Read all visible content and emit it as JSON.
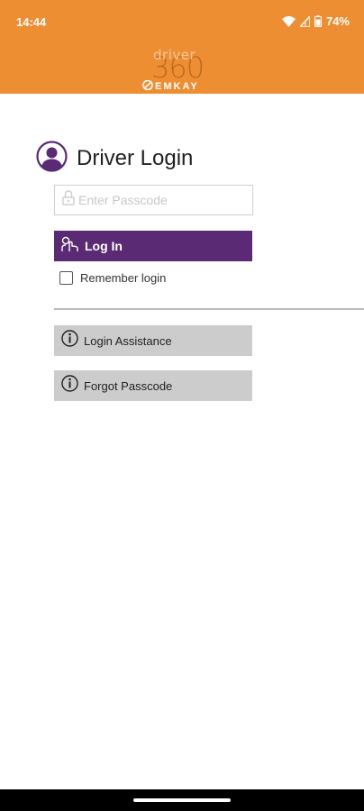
{
  "status_bar": {
    "time": "14:44",
    "battery": "74%",
    "icons": [
      "wifi-icon",
      "signal-icon",
      "battery-icon"
    ]
  },
  "header": {
    "logo": {
      "word_top": "driver",
      "word_mid": "360",
      "word_bottom": "EMKAY"
    }
  },
  "login": {
    "title": "Driver Login",
    "title_icon": "user-avatar-icon",
    "passcode_placeholder": "Enter Passcode",
    "passcode_value": "",
    "login_button": "Log In",
    "remember_label": "Remember login",
    "remember_checked": false
  },
  "help": {
    "assistance": "Login Assistance",
    "forgot": "Forgot Passcode"
  },
  "colors": {
    "header": "#ee8e33",
    "primary": "#5a2a74",
    "secondary_button": "#cccccc",
    "divider": "#b9b9b9"
  }
}
